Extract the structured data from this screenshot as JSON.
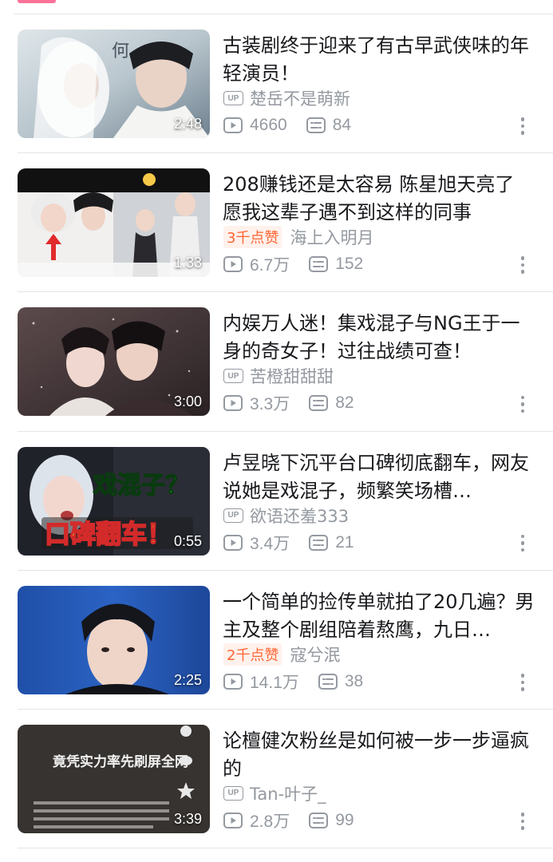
{
  "videos": [
    {
      "title": "古装剧终于迎来了有古早武侠味的年轻演员！",
      "badge_type": "up",
      "badge_text": "UP",
      "uploader": "楚岳不是萌新",
      "views": "4660",
      "danmaku": "84",
      "duration": "2:48",
      "thumb_text": ""
    },
    {
      "title": "208赚钱还是太容易 陈星旭天亮了 愿我这辈子遇不到这样的同事",
      "badge_type": "like",
      "badge_text": "3千点赞",
      "uploader": "海上入明月",
      "views": "6.7万",
      "danmaku": "152",
      "duration": "1:33",
      "thumb_text": ""
    },
    {
      "title": "内娱万人迷！集戏混子与NG王于一身的奇女子！过往战绩可查！",
      "badge_type": "up",
      "badge_text": "UP",
      "uploader": "苦橙甜甜甜",
      "views": "3.3万",
      "danmaku": "82",
      "duration": "3:00",
      "thumb_text": ""
    },
    {
      "title": "卢昱晓下沉平台口碑彻底翻车，网友说她是戏混子，频繁笑场槽…",
      "badge_type": "up",
      "badge_text": "UP",
      "uploader": "欲语还羞333",
      "views": "3.4万",
      "danmaku": "21",
      "duration": "0:55",
      "thumb_text": "戏混子？",
      "thumb_text2": "口碑翻车！"
    },
    {
      "title": "一个简单的捡传单就拍了20几遍？男主及整个剧组陪着熬鹰，九日…",
      "badge_type": "like",
      "badge_text": "2千点赞",
      "uploader": "寇兮泯",
      "views": "14.1万",
      "danmaku": "38",
      "duration": "2:25",
      "thumb_text": ""
    },
    {
      "title": "论檀健次粉丝是如何被一步一步逼疯的",
      "badge_type": "up",
      "badge_text": "UP",
      "uploader": "Tan-叶子_",
      "views": "2.8万",
      "danmaku": "99",
      "duration": "3:39",
      "thumb_text": "竟凭实力率先刷屏全网"
    }
  ],
  "colors": {
    "accent": "#fb7299",
    "meta_gray": "#9499a0",
    "like_orange": "#ff6633",
    "like_bg": "#fff1ec",
    "title_text": "#18191c"
  },
  "icons": {
    "views": "play-count-icon",
    "danmaku": "danmaku-count-icon",
    "more": "more-vertical-icon"
  }
}
